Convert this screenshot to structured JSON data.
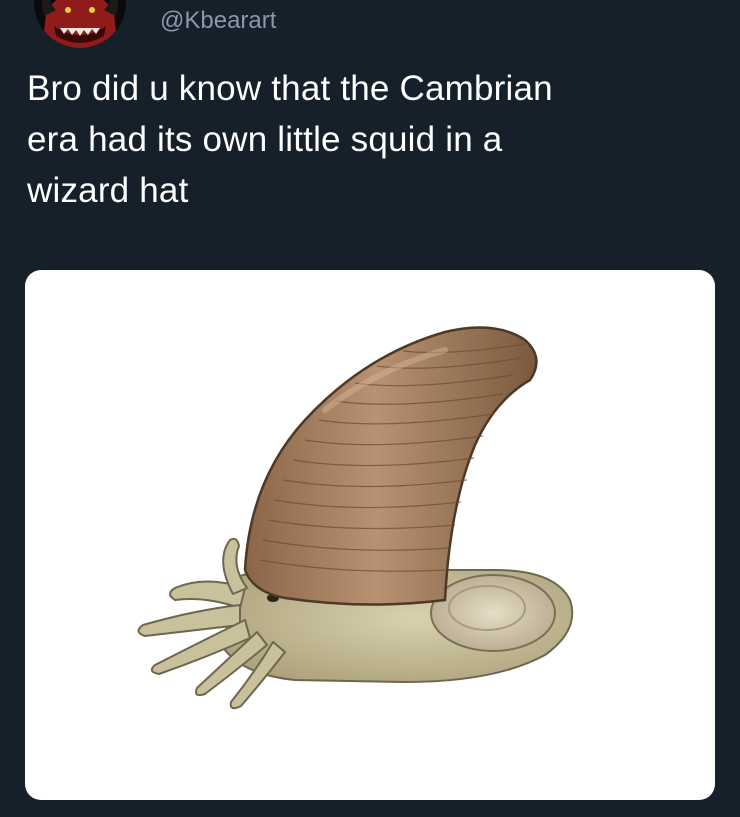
{
  "tweet": {
    "handle": "@Kbearart",
    "text_lines": [
      "Bro did u know that the Cambrian",
      "era had its own little squid in a",
      "wizard hat"
    ]
  },
  "avatar": {
    "icon": "avatar-demon-icon",
    "colors": {
      "skin": "#8f1b1b",
      "hair": "#0a0a0a",
      "teeth": "#e8e8e0"
    }
  },
  "media": {
    "icon": "squid-wizard-hat-illustration",
    "colors": {
      "background": "#ffffff",
      "shell": "#b08a66",
      "shell_shadow": "#7e5c40",
      "body": "#cbc39a",
      "body_shadow": "#9e9470"
    }
  },
  "theme": {
    "background": "#15202b",
    "text": "#ffffff",
    "muted": "#8899a6"
  }
}
